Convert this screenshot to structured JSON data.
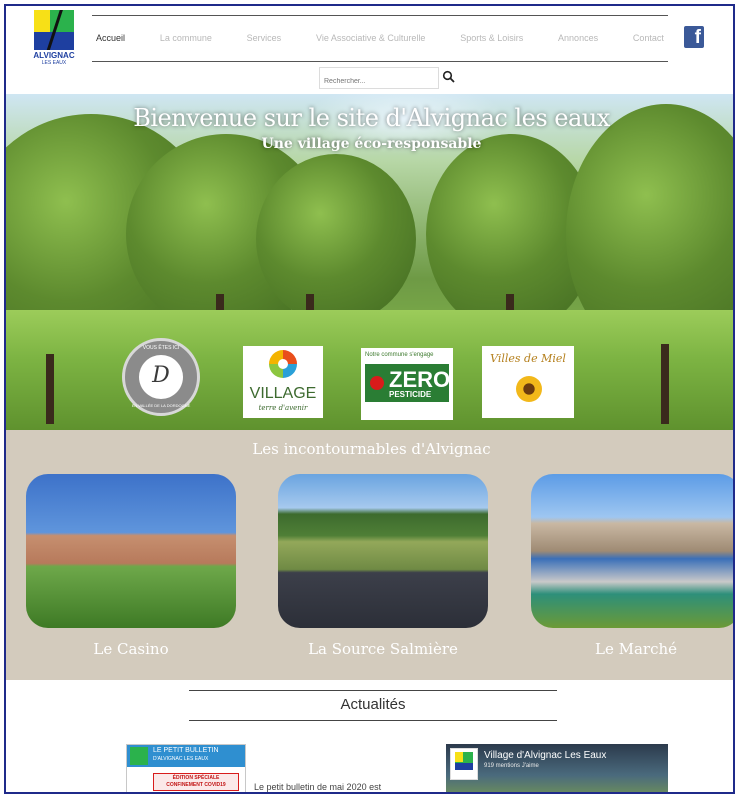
{
  "brand": {
    "name": "ALVIGNAC",
    "sub": "LES EAUX",
    "colors": {
      "green": "#2bb24c",
      "yellow": "#f7e017",
      "blue": "#1e3fa0"
    }
  },
  "nav": {
    "items": [
      {
        "label": "Accueil",
        "active": true
      },
      {
        "label": "La commune",
        "active": false
      },
      {
        "label": "Services",
        "active": false
      },
      {
        "label": "Vie Associative & Culturelle",
        "active": false
      },
      {
        "label": "Sports & Loisirs",
        "active": false
      },
      {
        "label": "Annonces",
        "active": false
      },
      {
        "label": "Contact",
        "active": false
      }
    ],
    "facebook_icon": "facebook-icon",
    "facebook_glyph": "f"
  },
  "search": {
    "placeholder": "Rechercher...",
    "icon": "search-icon"
  },
  "hero": {
    "title": "Bienvenue sur le site d'Alvignac les eaux",
    "subtitle": "Une village éco-responsable",
    "badges": {
      "dordogne": {
        "letter": "D",
        "ring_top": "VOUS ÊTES ICI",
        "ring_bottom": "EN VALLÉE DE LA DORDOGNE"
      },
      "village": {
        "line1": "VILLAGE",
        "line2": "terre d'avenir"
      },
      "zero": {
        "engage": "Notre commune s'engage",
        "zero": "ZERO",
        "pesticide": "PESTICIDE"
      },
      "miel": {
        "text": "Villes de Miel"
      }
    }
  },
  "incontournables": {
    "title": "Les incontournables d'Alvignac",
    "cards": [
      {
        "label": "Le Casino"
      },
      {
        "label": "La Source Salmière"
      },
      {
        "label": "Le Marché"
      }
    ]
  },
  "actualites": {
    "title": "Actualités",
    "bulletin": {
      "header_line1": "LE PETIT BULLETIN",
      "header_line2": "D'ALVIGNAC LES EAUX",
      "red_line1": "ÉDITION SPÉCIALE",
      "red_line2": "CONFINEMENT COVID19",
      "text": "Le petit bulletin de mai 2020 est"
    },
    "facebook_page": {
      "name": "Village d'Alvignac Les Eaux",
      "likes": "919 mentions J'aime"
    }
  }
}
